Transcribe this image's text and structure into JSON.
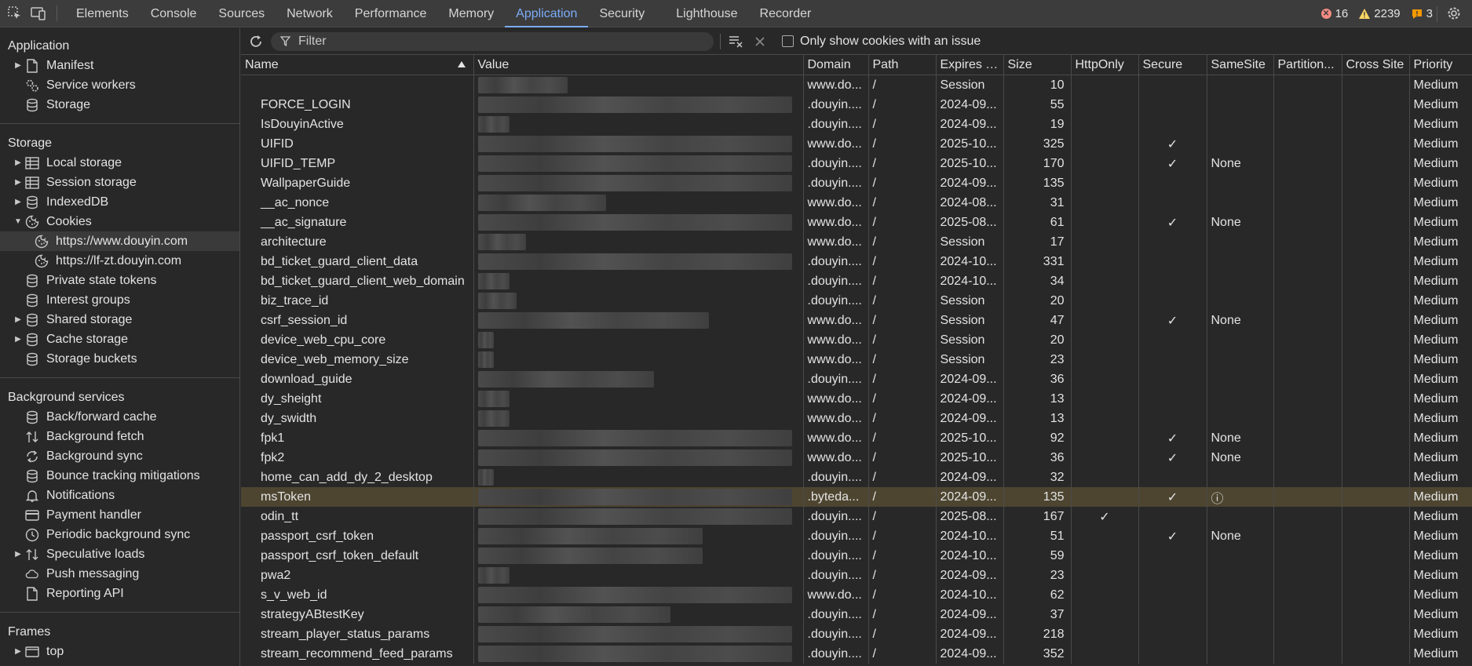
{
  "tabs": [
    "Elements",
    "Console",
    "Sources",
    "Network",
    "Performance",
    "Memory",
    "Application",
    "Security",
    "Lighthouse",
    "Recorder"
  ],
  "active_tab": "Application",
  "status": {
    "errors": "16",
    "warnings": "2239",
    "issues": "3",
    "colors": {
      "error": "#f28b82",
      "warning": "#fdd663",
      "issue": "#f29900"
    }
  },
  "sidebar": {
    "application": {
      "title": "Application",
      "items": [
        {
          "label": "Manifest",
          "icon": "document-icon",
          "arrow": true
        },
        {
          "label": "Service workers",
          "icon": "gears-icon",
          "arrow": false
        },
        {
          "label": "Storage",
          "icon": "database-icon",
          "arrow": false
        }
      ]
    },
    "storage": {
      "title": "Storage",
      "items": [
        {
          "label": "Local storage",
          "icon": "table-icon",
          "arrow": true
        },
        {
          "label": "Session storage",
          "icon": "table-icon",
          "arrow": true
        },
        {
          "label": "IndexedDB",
          "icon": "database-icon",
          "arrow": true
        },
        {
          "label": "Cookies",
          "icon": "cookie-icon",
          "arrow": true,
          "expanded": true
        },
        {
          "label": "https://www.douyin.com",
          "icon": "cookie-icon",
          "child": true,
          "selected": true
        },
        {
          "label": "https://lf-zt.douyin.com",
          "icon": "cookie-icon",
          "child": true
        },
        {
          "label": "Private state tokens",
          "icon": "database-icon",
          "arrow": false
        },
        {
          "label": "Interest groups",
          "icon": "database-icon",
          "arrow": false
        },
        {
          "label": "Shared storage",
          "icon": "database-icon",
          "arrow": true
        },
        {
          "label": "Cache storage",
          "icon": "database-icon",
          "arrow": true
        },
        {
          "label": "Storage buckets",
          "icon": "database-icon",
          "arrow": false
        }
      ]
    },
    "background": {
      "title": "Background services",
      "items": [
        {
          "label": "Back/forward cache",
          "icon": "database-icon",
          "arrow": false
        },
        {
          "label": "Background fetch",
          "icon": "updown-arrows-icon",
          "arrow": false
        },
        {
          "label": "Background sync",
          "icon": "sync-icon",
          "arrow": false
        },
        {
          "label": "Bounce tracking mitigations",
          "icon": "database-icon",
          "arrow": false
        },
        {
          "label": "Notifications",
          "icon": "bell-icon",
          "arrow": false
        },
        {
          "label": "Payment handler",
          "icon": "card-icon",
          "arrow": false
        },
        {
          "label": "Periodic background sync",
          "icon": "clock-icon",
          "arrow": false
        },
        {
          "label": "Speculative loads",
          "icon": "updown-arrows-icon",
          "arrow": true
        },
        {
          "label": "Push messaging",
          "icon": "cloud-icon",
          "arrow": false
        },
        {
          "label": "Reporting API",
          "icon": "document-icon",
          "arrow": false
        }
      ]
    },
    "frames": {
      "title": "Frames",
      "items": [
        {
          "label": "top",
          "icon": "frame-icon",
          "arrow": true
        }
      ]
    }
  },
  "toolbar": {
    "filter_placeholder": "Filter",
    "only_issue_label": "Only show cookies with an issue"
  },
  "table": {
    "columns": [
      "Name",
      "Value",
      "Domain",
      "Path",
      "Expires /...",
      "Size",
      "HttpOnly",
      "Secure",
      "SameSite",
      "Partition...",
      "Cross Site",
      "Priority"
    ],
    "rows": [
      {
        "name": "",
        "domain": "www.do...",
        "path": "/",
        "expires": "Session",
        "size": "10",
        "httponly": "",
        "secure": "",
        "samesite": "",
        "priority": "Medium",
        "blur": 0.28
      },
      {
        "name": "FORCE_LOGIN",
        "domain": ".douyin....",
        "path": "/",
        "expires": "2024-09...",
        "size": "55",
        "httponly": "",
        "secure": "",
        "samesite": "",
        "priority": "Medium",
        "blur": 0.98
      },
      {
        "name": "IsDouyinActive",
        "domain": ".douyin....",
        "path": "/",
        "expires": "2024-09...",
        "size": "19",
        "httponly": "",
        "secure": "",
        "samesite": "",
        "priority": "Medium",
        "blur": 0.1
      },
      {
        "name": "UIFID",
        "domain": "www.do...",
        "path": "/",
        "expires": "2025-10...",
        "size": "325",
        "httponly": "",
        "secure": "✓",
        "samesite": "",
        "priority": "Medium",
        "blur": 0.98
      },
      {
        "name": "UIFID_TEMP",
        "domain": ".douyin....",
        "path": "/",
        "expires": "2025-10...",
        "size": "170",
        "httponly": "",
        "secure": "✓",
        "samesite": "None",
        "priority": "Medium",
        "blur": 0.98
      },
      {
        "name": "WallpaperGuide",
        "domain": ".douyin....",
        "path": "/",
        "expires": "2024-09...",
        "size": "135",
        "httponly": "",
        "secure": "",
        "samesite": "",
        "priority": "Medium",
        "blur": 0.98
      },
      {
        "name": "__ac_nonce",
        "domain": "www.do...",
        "path": "/",
        "expires": "2024-08...",
        "size": "31",
        "httponly": "",
        "secure": "",
        "samesite": "",
        "priority": "Medium",
        "blur": 0.4
      },
      {
        "name": "__ac_signature",
        "domain": "www.do...",
        "path": "/",
        "expires": "2025-08...",
        "size": "61",
        "httponly": "",
        "secure": "✓",
        "samesite": "None",
        "priority": "Medium",
        "blur": 0.98
      },
      {
        "name": "architecture",
        "domain": "www.do...",
        "path": "/",
        "expires": "Session",
        "size": "17",
        "httponly": "",
        "secure": "",
        "samesite": "",
        "priority": "Medium",
        "blur": 0.15
      },
      {
        "name": "bd_ticket_guard_client_data",
        "domain": ".douyin....",
        "path": "/",
        "expires": "2024-10...",
        "size": "331",
        "httponly": "",
        "secure": "",
        "samesite": "",
        "priority": "Medium",
        "blur": 0.98
      },
      {
        "name": "bd_ticket_guard_client_web_domain",
        "domain": ".douyin....",
        "path": "/",
        "expires": "2024-10...",
        "size": "34",
        "httponly": "",
        "secure": "",
        "samesite": "",
        "priority": "Medium",
        "blur": 0.1
      },
      {
        "name": "biz_trace_id",
        "domain": ".douyin....",
        "path": "/",
        "expires": "Session",
        "size": "20",
        "httponly": "",
        "secure": "",
        "samesite": "",
        "priority": "Medium",
        "blur": 0.12
      },
      {
        "name": "csrf_session_id",
        "domain": "www.do...",
        "path": "/",
        "expires": "Session",
        "size": "47",
        "httponly": "",
        "secure": "✓",
        "samesite": "None",
        "priority": "Medium",
        "blur": 0.72
      },
      {
        "name": "device_web_cpu_core",
        "domain": "www.do...",
        "path": "/",
        "expires": "Session",
        "size": "20",
        "httponly": "",
        "secure": "",
        "samesite": "",
        "priority": "Medium",
        "blur": 0.05
      },
      {
        "name": "device_web_memory_size",
        "domain": "www.do...",
        "path": "/",
        "expires": "Session",
        "size": "23",
        "httponly": "",
        "secure": "",
        "samesite": "",
        "priority": "Medium",
        "blur": 0.05
      },
      {
        "name": "download_guide",
        "domain": ".douyin....",
        "path": "/",
        "expires": "2024-09...",
        "size": "36",
        "httponly": "",
        "secure": "",
        "samesite": "",
        "priority": "Medium",
        "blur": 0.55
      },
      {
        "name": "dy_sheight",
        "domain": "www.do...",
        "path": "/",
        "expires": "2024-09...",
        "size": "13",
        "httponly": "",
        "secure": "",
        "samesite": "",
        "priority": "Medium",
        "blur": 0.1
      },
      {
        "name": "dy_swidth",
        "domain": "www.do...",
        "path": "/",
        "expires": "2024-09...",
        "size": "13",
        "httponly": "",
        "secure": "",
        "samesite": "",
        "priority": "Medium",
        "blur": 0.1
      },
      {
        "name": "fpk1",
        "domain": "www.do...",
        "path": "/",
        "expires": "2025-10...",
        "size": "92",
        "httponly": "",
        "secure": "✓",
        "samesite": "None",
        "priority": "Medium",
        "blur": 0.98
      },
      {
        "name": "fpk2",
        "domain": "www.do...",
        "path": "/",
        "expires": "2025-10...",
        "size": "36",
        "httponly": "",
        "secure": "✓",
        "samesite": "None",
        "priority": "Medium",
        "blur": 0.98
      },
      {
        "name": "home_can_add_dy_2_desktop",
        "domain": ".douyin....",
        "path": "/",
        "expires": "2024-09...",
        "size": "32",
        "httponly": "",
        "secure": "",
        "samesite": "",
        "priority": "Medium",
        "blur": 0.05
      },
      {
        "name": "msToken",
        "domain": ".byteda...",
        "path": "/",
        "expires": "2024-09...",
        "size": "135",
        "httponly": "",
        "secure": "✓",
        "samesite": "ⓘ",
        "priority": "Medium",
        "blur": 0.98,
        "highlight": true
      },
      {
        "name": "odin_tt",
        "domain": ".douyin....",
        "path": "/",
        "expires": "2025-08...",
        "size": "167",
        "httponly": "✓",
        "secure": "",
        "samesite": "",
        "priority": "Medium",
        "blur": 0.98
      },
      {
        "name": "passport_csrf_token",
        "domain": ".douyin....",
        "path": "/",
        "expires": "2024-10...",
        "size": "51",
        "httponly": "",
        "secure": "✓",
        "samesite": "None",
        "priority": "Medium",
        "blur": 0.7
      },
      {
        "name": "passport_csrf_token_default",
        "domain": ".douyin....",
        "path": "/",
        "expires": "2024-10...",
        "size": "59",
        "httponly": "",
        "secure": "",
        "samesite": "",
        "priority": "Medium",
        "blur": 0.7
      },
      {
        "name": "pwa2",
        "domain": ".douyin....",
        "path": "/",
        "expires": "2024-09...",
        "size": "23",
        "httponly": "",
        "secure": "",
        "samesite": "",
        "priority": "Medium",
        "blur": 0.1
      },
      {
        "name": "s_v_web_id",
        "domain": "www.do...",
        "path": "/",
        "expires": "2024-10...",
        "size": "62",
        "httponly": "",
        "secure": "",
        "samesite": "",
        "priority": "Medium",
        "blur": 0.98
      },
      {
        "name": "strategyABtestKey",
        "domain": ".douyin....",
        "path": "/",
        "expires": "2024-09...",
        "size": "37",
        "httponly": "",
        "secure": "",
        "samesite": "",
        "priority": "Medium",
        "blur": 0.6
      },
      {
        "name": "stream_player_status_params",
        "domain": ".douyin....",
        "path": "/",
        "expires": "2024-09...",
        "size": "218",
        "httponly": "",
        "secure": "",
        "samesite": "",
        "priority": "Medium",
        "blur": 0.98
      },
      {
        "name": "stream_recommend_feed_params",
        "domain": ".douyin....",
        "path": "/",
        "expires": "2024-09...",
        "size": "352",
        "httponly": "",
        "secure": "",
        "samesite": "",
        "priority": "Medium",
        "blur": 0.98
      }
    ]
  }
}
